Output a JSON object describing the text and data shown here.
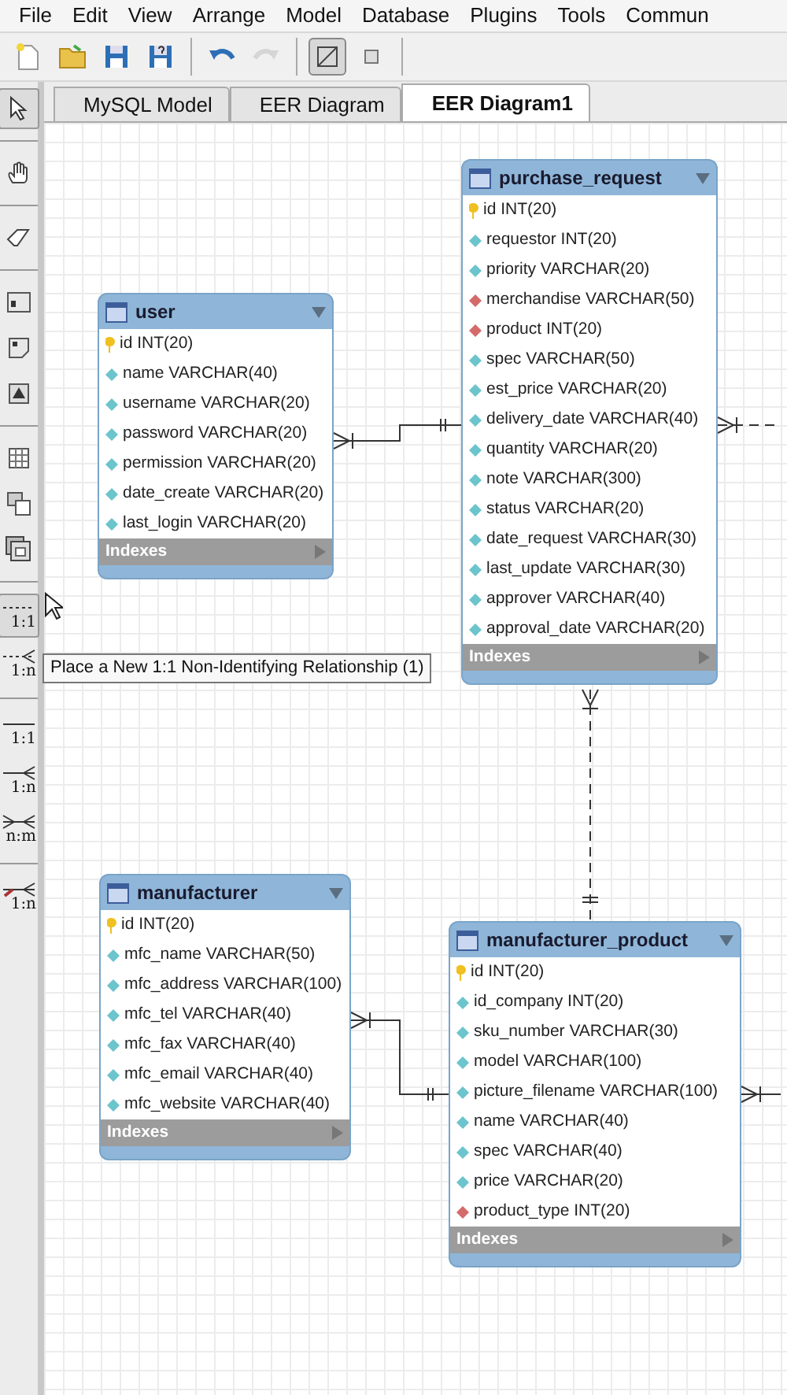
{
  "menu": [
    "File",
    "Edit",
    "View",
    "Arrange",
    "Model",
    "Database",
    "Plugins",
    "Tools",
    "Commun"
  ],
  "toolbar": [
    {
      "kind": "new",
      "disabled": false,
      "selected": false
    },
    {
      "kind": "open",
      "disabled": false,
      "selected": false
    },
    {
      "kind": "save",
      "disabled": false,
      "selected": false
    },
    {
      "kind": "saveas",
      "disabled": false,
      "selected": false
    },
    {
      "kind": "sep"
    },
    {
      "kind": "undo",
      "disabled": false,
      "selected": false
    },
    {
      "kind": "redo",
      "disabled": true,
      "selected": false
    },
    {
      "kind": "sep"
    },
    {
      "kind": "grid",
      "disabled": false,
      "selected": true
    },
    {
      "kind": "square",
      "disabled": false,
      "selected": false
    },
    {
      "kind": "sep"
    }
  ],
  "toolbox": [
    {
      "kind": "pointer",
      "selected": true
    },
    {
      "kind": "sep"
    },
    {
      "kind": "hand",
      "selected": false
    },
    {
      "kind": "sep"
    },
    {
      "kind": "eraser",
      "selected": false
    },
    {
      "kind": "sep"
    },
    {
      "kind": "layer",
      "selected": false
    },
    {
      "kind": "note",
      "selected": false
    },
    {
      "kind": "image",
      "selected": false
    },
    {
      "kind": "sep"
    },
    {
      "kind": "table",
      "selected": false
    },
    {
      "kind": "view",
      "selected": false
    },
    {
      "kind": "routine",
      "selected": false
    },
    {
      "kind": "sep"
    },
    {
      "kind": "dashone",
      "label": "1:1",
      "selected": true
    },
    {
      "kind": "dashmany",
      "label": "1:n",
      "selected": false
    },
    {
      "kind": "sep"
    },
    {
      "kind": "solidone",
      "label": "1:1",
      "selected": false
    },
    {
      "kind": "solidmany",
      "label": "1:n",
      "selected": false
    },
    {
      "kind": "solidboth",
      "label": "n:m",
      "selected": false
    },
    {
      "kind": "sep"
    },
    {
      "kind": "solidpick",
      "label": "1:n",
      "selected": false
    }
  ],
  "tabs": [
    {
      "label": "MySQL Model",
      "selected": false
    },
    {
      "label": "EER Diagram",
      "selected": false
    },
    {
      "label": "EER Diagram1",
      "selected": true
    }
  ],
  "tables": [
    {
      "name": "user",
      "footer": "Indexes",
      "columns": [
        {
          "kind": "pk",
          "text": "id INT(20)"
        },
        {
          "kind": "col",
          "text": "name VARCHAR(40)"
        },
        {
          "kind": "col",
          "text": "username VARCHAR(20)"
        },
        {
          "kind": "col",
          "text": "password VARCHAR(20)"
        },
        {
          "kind": "col",
          "text": "permission VARCHAR(20)"
        },
        {
          "kind": "col",
          "text": "date_create VARCHAR(20)"
        },
        {
          "kind": "col",
          "text": "last_login VARCHAR(20)"
        }
      ]
    },
    {
      "name": "purchase_request",
      "footer": "Indexes",
      "columns": [
        {
          "kind": "pk",
          "text": "id INT(20)"
        },
        {
          "kind": "col",
          "text": "requestor INT(20)"
        },
        {
          "kind": "col",
          "text": "priority VARCHAR(20)"
        },
        {
          "kind": "fk",
          "text": "merchandise VARCHAR(50)"
        },
        {
          "kind": "fk",
          "text": "product INT(20)"
        },
        {
          "kind": "col",
          "text": "spec VARCHAR(50)"
        },
        {
          "kind": "col",
          "text": "est_price VARCHAR(20)"
        },
        {
          "kind": "col",
          "text": "delivery_date VARCHAR(40)"
        },
        {
          "kind": "col",
          "text": "quantity VARCHAR(20)"
        },
        {
          "kind": "col",
          "text": "note VARCHAR(300)"
        },
        {
          "kind": "col",
          "text": "status VARCHAR(20)"
        },
        {
          "kind": "col",
          "text": "date_request VARCHAR(30)"
        },
        {
          "kind": "col",
          "text": "last_update VARCHAR(30)"
        },
        {
          "kind": "col",
          "text": "approver VARCHAR(40)"
        },
        {
          "kind": "col",
          "text": "approval_date VARCHAR(20)"
        }
      ]
    },
    {
      "name": "manufacturer",
      "footer": "Indexes",
      "columns": [
        {
          "kind": "pk",
          "text": "id INT(20)"
        },
        {
          "kind": "col",
          "text": "mfc_name VARCHAR(50)"
        },
        {
          "kind": "col",
          "text": "mfc_address VARCHAR(100)"
        },
        {
          "kind": "col",
          "text": "mfc_tel VARCHAR(40)"
        },
        {
          "kind": "col",
          "text": "mfc_fax VARCHAR(40)"
        },
        {
          "kind": "col",
          "text": "mfc_email VARCHAR(40)"
        },
        {
          "kind": "col",
          "text": "mfc_website VARCHAR(40)"
        }
      ]
    },
    {
      "name": "manufacturer_product",
      "footer": "Indexes",
      "columns": [
        {
          "kind": "pk",
          "text": "id INT(20)"
        },
        {
          "kind": "col",
          "text": "id_company INT(20)"
        },
        {
          "kind": "col",
          "text": "sku_number VARCHAR(30)"
        },
        {
          "kind": "col",
          "text": "model VARCHAR(100)"
        },
        {
          "kind": "col",
          "text": "picture_filename VARCHAR(100)"
        },
        {
          "kind": "col",
          "text": "name VARCHAR(40)"
        },
        {
          "kind": "col",
          "text": "spec VARCHAR(40)"
        },
        {
          "kind": "col",
          "text": "price VARCHAR(20)"
        },
        {
          "kind": "fk",
          "text": "product_type INT(20)"
        }
      ]
    }
  ],
  "relationships": [
    {
      "kind": "identifying"
    },
    {
      "kind": "nonidentifying"
    },
    {
      "kind": "nonidentifying"
    },
    {
      "kind": "identifying"
    },
    {
      "kind": "identifying"
    }
  ],
  "tooltip": "Place a New 1:1 Non-Identifying Relationship (1)"
}
